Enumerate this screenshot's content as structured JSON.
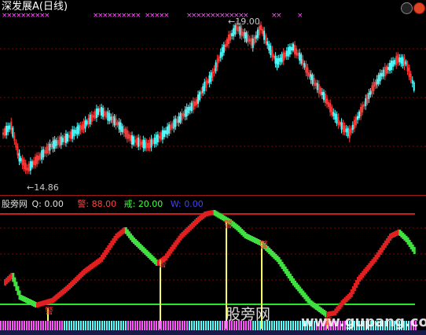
{
  "header": {
    "title": "深发展A",
    "period": "(日线)"
  },
  "main_chart": {
    "high_label": "19.00",
    "low_label": "14.86",
    "x_marker_glyph": "×"
  },
  "sub_chart": {
    "name": "股旁网",
    "q_label": "Q:",
    "q_value": "0.00",
    "line1_label": "警:",
    "line1_value": "88.00",
    "line2_label": "戒:",
    "line2_value": "20.00",
    "line3_label": "W:",
    "line3_value": "0.00",
    "signal_glyph": "警"
  },
  "watermark": {
    "site_name": "股旁网",
    "url": "www.gupang.com"
  },
  "colors": {
    "bull": "#ff3c3c",
    "bear": "#54ffff",
    "grid": "#8b0000",
    "red_line": "#c81e1e",
    "green_line": "#28e628",
    "yellow_line": "#ffff66",
    "magenta": "#ff55ff",
    "cyan": "#55ffff",
    "blue": "#3b3bff",
    "text": "#c8c8c8"
  }
}
